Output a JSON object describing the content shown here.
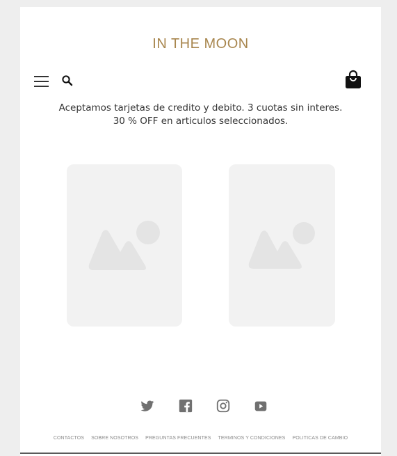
{
  "header": {
    "brand": "IN THE MOON",
    "menu_icon": "hamburger-menu-icon",
    "search_icon": "search-icon",
    "cart_icon": "shopping-bag-icon"
  },
  "announcement": {
    "line1": "Aceptamos tarjetas de credito y debito. 3 cuotas sin interes.",
    "line2": "30 % OFF en articulos seleccionados."
  },
  "products": [
    {
      "image_icon": "image-placeholder-icon"
    },
    {
      "image_icon": "image-placeholder-icon"
    }
  ],
  "social": [
    {
      "icon": "twitter-icon"
    },
    {
      "icon": "facebook-icon"
    },
    {
      "icon": "instagram-icon"
    },
    {
      "icon": "youtube-icon"
    }
  ],
  "footer": {
    "links": [
      "CONTACTOS",
      "SOBRE NOSOTROS",
      "PREGUNTAS FRECUENTES",
      "TERMINOS Y CONDICIONES",
      "POLITICAS DE CAMBIO"
    ]
  },
  "colors": {
    "brand": "#a8864e",
    "background": "#eeeeee",
    "placeholder": "#f2f2f2",
    "icon_gray": "#707070"
  }
}
